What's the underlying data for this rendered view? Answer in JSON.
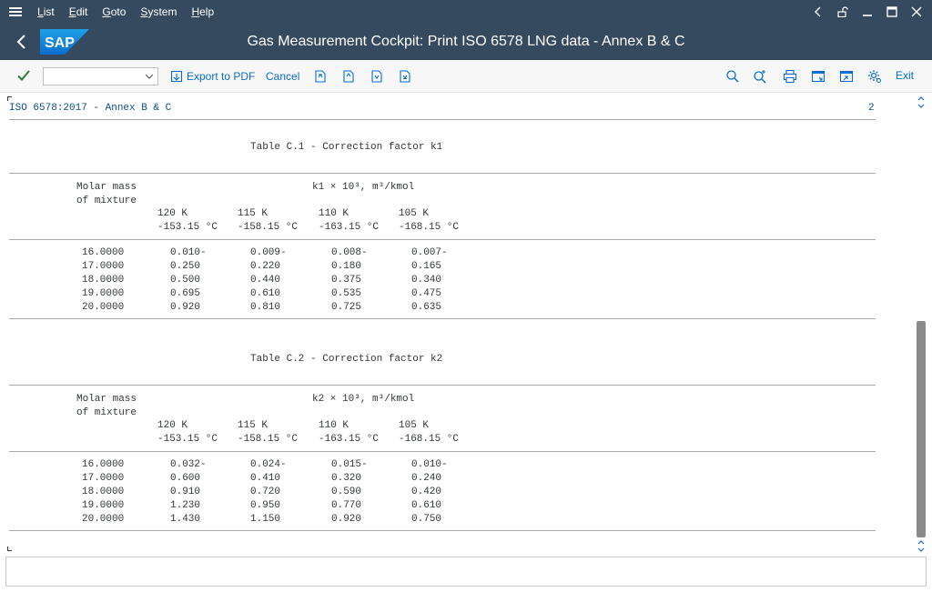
{
  "menu": {
    "items": [
      "List",
      "Edit",
      "Goto",
      "System",
      "Help"
    ]
  },
  "title": "Gas Measurement Cockpit: Print ISO 6578 LNG data - Annex B & C",
  "logo_text": "SAP",
  "toolbar": {
    "command_value": "",
    "export_label": "Export to PDF",
    "cancel_label": "Cancel",
    "exit_label": "Exit"
  },
  "colors": {
    "shell": "#354a5f",
    "link": "#0a6ed1",
    "ok_green": "#2b7d2b"
  },
  "report": {
    "header_left": "ISO 6578:2017 - Annex B & C",
    "page_number": "2",
    "tables": [
      {
        "title": "Table C.1 - Correction factor k1",
        "head_col1_line1": "Molar mass",
        "head_col1_line2": "of mixture",
        "unit_line": "k1 × 10³, m³/kmol",
        "temps_k": [
          "120 K",
          "115 K",
          "110 K",
          "105 K"
        ],
        "temps_c": [
          "-153.15 °C",
          "-158.15 °C",
          "-163.15 °C",
          "-168.15 °C"
        ],
        "rows": [
          [
            "16.0000",
            "0.010-",
            "0.009-",
            "0.008-",
            "0.007-"
          ],
          [
            "17.0000",
            "0.250",
            "0.220",
            "0.180",
            "0.165"
          ],
          [
            "18.0000",
            "0.500",
            "0.440",
            "0.375",
            "0.340"
          ],
          [
            "19.0000",
            "0.695",
            "0.610",
            "0.535",
            "0.475"
          ],
          [
            "20.0000",
            "0.920",
            "0.810",
            "0.725",
            "0.635"
          ]
        ]
      },
      {
        "title": "Table C.2 - Correction factor k2",
        "head_col1_line1": "Molar mass",
        "head_col1_line2": "of mixture",
        "unit_line": "k2 × 10³, m³/kmol",
        "temps_k": [
          "120 K",
          "115 K",
          "110 K",
          "105 K"
        ],
        "temps_c": [
          "-153.15 °C",
          "-158.15 °C",
          "-163.15 °C",
          "-168.15 °C"
        ],
        "rows": [
          [
            "16.0000",
            "0.032-",
            "0.024-",
            "0.015-",
            "0.010-"
          ],
          [
            "17.0000",
            "0.600",
            "0.410",
            "0.320",
            "0.240"
          ],
          [
            "18.0000",
            "0.910",
            "0.720",
            "0.590",
            "0.420"
          ],
          [
            "19.0000",
            "1.230",
            "0.950",
            "0.770",
            "0.610"
          ],
          [
            "20.0000",
            "1.430",
            "1.150",
            "0.920",
            "0.750"
          ]
        ]
      }
    ]
  },
  "statusbar": {
    "message": ""
  }
}
